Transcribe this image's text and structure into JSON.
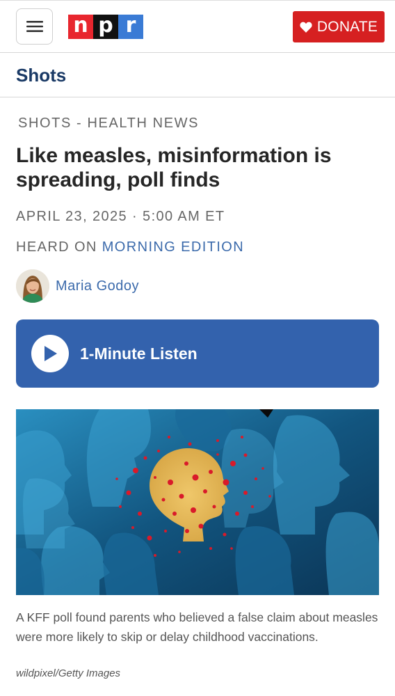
{
  "header": {
    "menu_icon": "hamburger-icon",
    "logo_letters": [
      "n",
      "p",
      "r"
    ],
    "donate_label": "DONATE",
    "donate_icon": "heart-icon",
    "brand_colors": {
      "red": "#e8262e",
      "black": "#111111",
      "blue": "#3a7bd5",
      "donate": "#d62021"
    }
  },
  "section": {
    "label": "Shots"
  },
  "article": {
    "kicker": "SHOTS - HEALTH NEWS",
    "headline": "Like measles, misinformation is spreading, poll finds",
    "date": "APRIL 23, 2025 · 5:00 AM ET",
    "heard_on_prefix": "HEARD ON",
    "program": "MORNING EDITION",
    "author": "Maria Godoy"
  },
  "audio": {
    "label": "1-Minute Listen",
    "icon": "play-icon"
  },
  "image": {
    "caption": "A KFF poll found parents who believed a false claim about measles were more likely to skip or delay childhood vaccinations.",
    "credit": "wildpixel/Getty Images"
  }
}
